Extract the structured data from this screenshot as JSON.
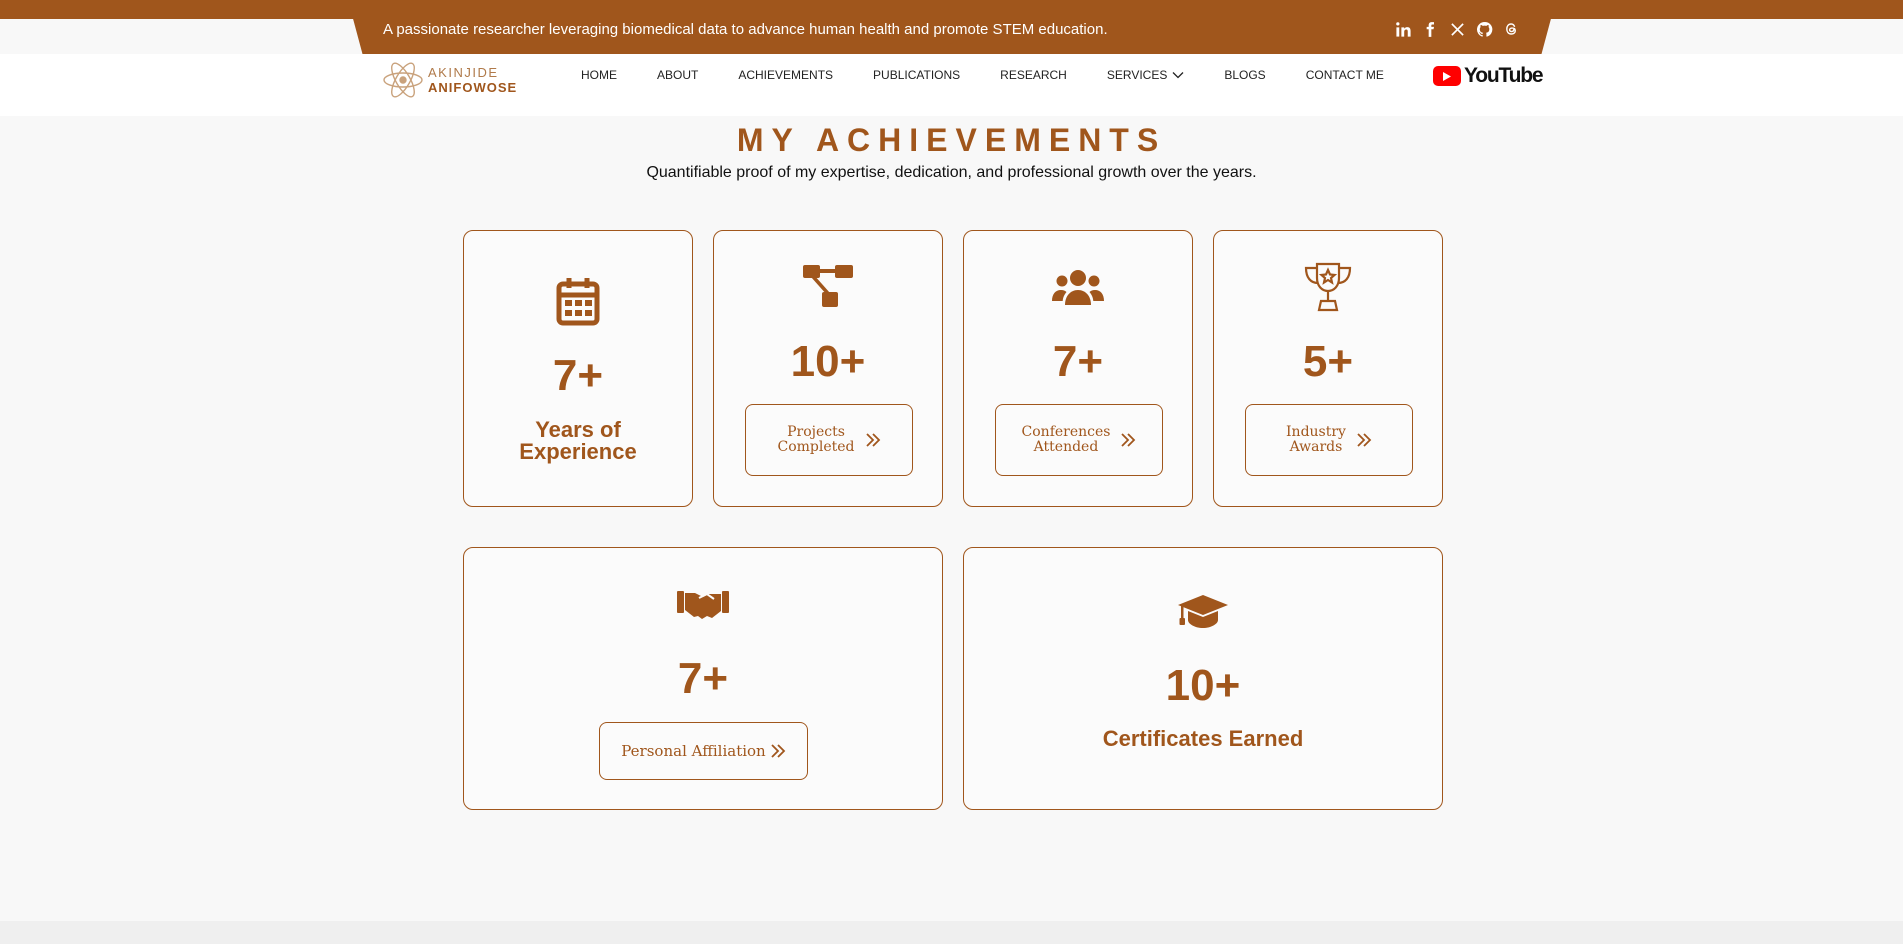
{
  "topbar": {
    "tagline": "A passionate researcher leveraging biomedical data to advance human health and promote STEM education.",
    "socials": [
      "linkedin-icon",
      "facebook-icon",
      "x-icon",
      "github-icon",
      "threads-icon"
    ]
  },
  "logo": {
    "line1": "AKINJIDE",
    "line2": "ANIFOWOSE"
  },
  "nav": {
    "home": "HOME",
    "about": "ABOUT",
    "achievements": "ACHIEVEMENTS",
    "publications": "PUBLICATIONS",
    "research": "RESEARCH",
    "services": "SERVICES",
    "blogs": "BLOGS",
    "contact": "CONTACT ME"
  },
  "youtube": {
    "label": "YouTube"
  },
  "section": {
    "title": "MY ACHIEVEMENTS",
    "subtitle": "Quantifiable proof of my expertise, dedication, and professional growth over the years."
  },
  "cards": {
    "experience": {
      "value": "7+",
      "label": "Years of\nExperience"
    },
    "projects": {
      "value": "10+",
      "button": "Projects\nCompleted"
    },
    "conferences": {
      "value": "7+",
      "button": "Conferences\nAttended"
    },
    "awards": {
      "value": "5+",
      "button": "Industry\nAwards"
    },
    "affiliation": {
      "value": "7+",
      "button": "Personal Affiliation"
    },
    "certificates": {
      "value": "10+",
      "label": "Certificates Earned"
    }
  },
  "colors": {
    "brand": "#a0561c",
    "background": "#f8f8f8"
  }
}
